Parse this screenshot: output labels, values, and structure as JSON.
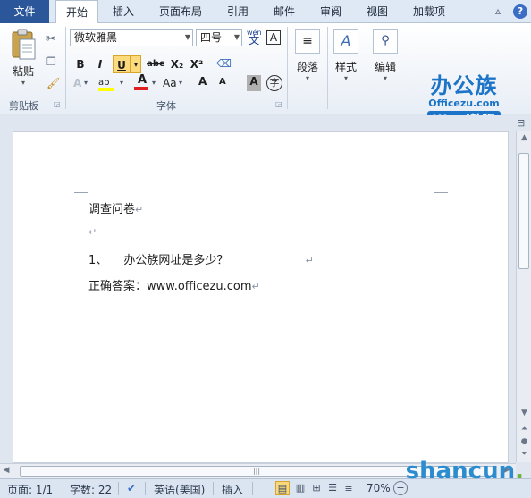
{
  "tabs": [
    "文件",
    "开始",
    "插入",
    "页面布局",
    "引用",
    "邮件",
    "审阅",
    "视图",
    "加载项"
  ],
  "clipboard": {
    "paste_label": "粘贴",
    "group_label": "剪贴板"
  },
  "font": {
    "font_name": "微软雅黑",
    "font_size": "四号",
    "wen_label": "wén",
    "a_box": "A",
    "bold": "B",
    "italic": "I",
    "underline": "U",
    "strike": "abc",
    "subscript": "X₂",
    "superscript": "X²",
    "aa_label": "Aa",
    "grow": "A",
    "shrink": "A",
    "char_shading": "A",
    "enclose": "字",
    "group_label": "字体"
  },
  "paragraph": {
    "label": "段落"
  },
  "styles": {
    "label": "样式"
  },
  "editing": {
    "label": "编辑"
  },
  "logo": {
    "main": "办公族",
    "url": "Officezu.com",
    "tag": "Word教程"
  },
  "document": {
    "line1": "调查问卷",
    "line3_num": "1、",
    "line3_text": "办公族网址是多少？",
    "line3_blank": "____________",
    "line4_prefix": "正确答案：",
    "line4_link": "www.officezu.com",
    "para_mark": "↵"
  },
  "status": {
    "page": "页面: 1/1",
    "words": "字数: 22",
    "language": "英语(美国)",
    "insert_mode": "插入",
    "zoom": "70%"
  },
  "watermark": {
    "brand": "shancun",
    "dot": "."
  }
}
